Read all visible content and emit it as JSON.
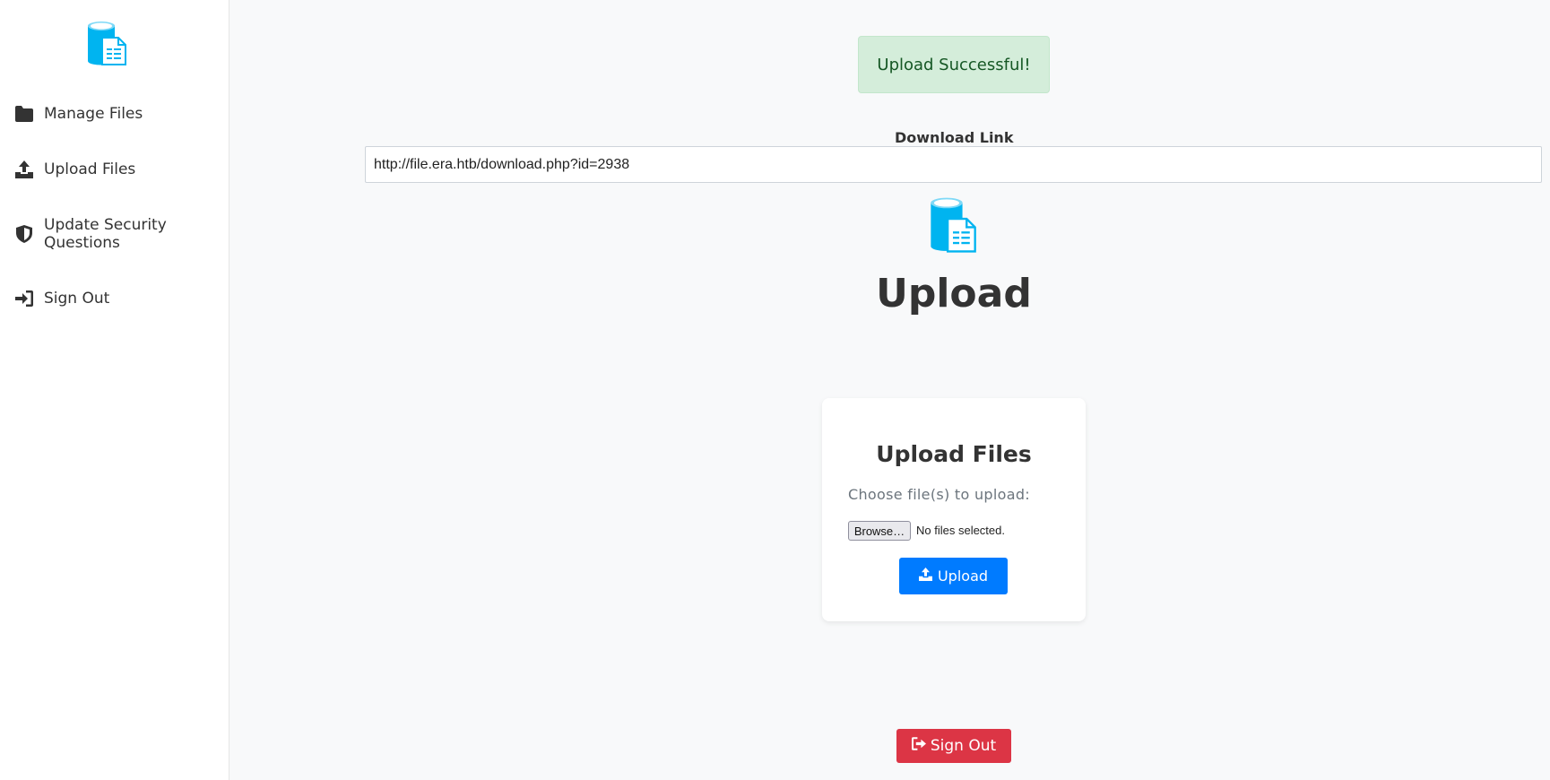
{
  "sidebar": {
    "logo_icon": "file-storage-icon",
    "items": [
      {
        "label": "Manage Files",
        "icon": "folder-icon"
      },
      {
        "label": "Upload Files",
        "icon": "upload-icon"
      },
      {
        "label": "Update Security Questions",
        "icon": "shield-icon"
      },
      {
        "label": "Sign Out",
        "icon": "sign-in-icon"
      }
    ]
  },
  "alert": {
    "text": "Upload Successful!"
  },
  "download": {
    "label": "Download Link",
    "url": "http://file.era.htb/download.php?id=2938"
  },
  "main": {
    "title": "Upload",
    "logo_icon": "file-storage-icon"
  },
  "upload_card": {
    "title": "Upload Files",
    "subtitle": "Choose file(s) to upload:",
    "browse_label": "Browse…",
    "no_files_text": "No files selected.",
    "upload_label": "Upload"
  },
  "signout": {
    "label": "Sign Out"
  },
  "colors": {
    "accent": "#00b4f0",
    "primary": "#007bff",
    "danger": "#dc3545",
    "success_bg": "#d4edda",
    "success_text": "#155724"
  }
}
